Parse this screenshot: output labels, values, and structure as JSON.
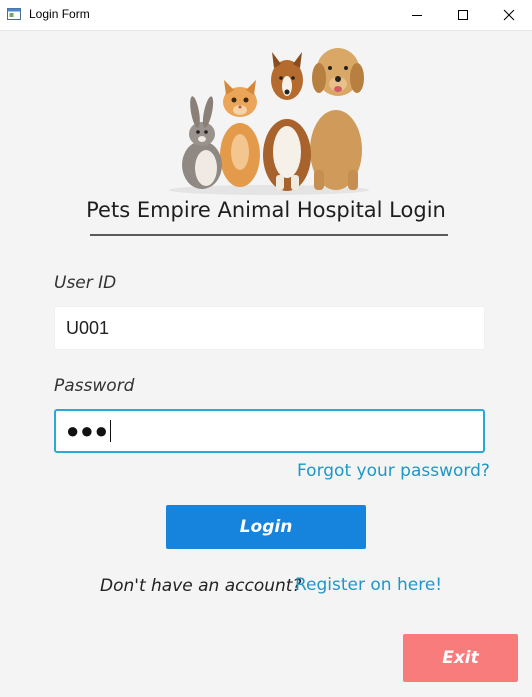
{
  "window": {
    "title": "Login Form",
    "icon": "app-window-icon",
    "controls": [
      "minimize-icon",
      "maximize-icon",
      "close-icon"
    ]
  },
  "header": {
    "image": "pets-group-image",
    "title": "Pets Empire Animal Hospital Login"
  },
  "form": {
    "user_id_label": "User ID",
    "user_id_value": "U001",
    "password_label": "Password",
    "password_masked": "●●●",
    "forgot_password": "Forgot your password?",
    "login_label": "Login"
  },
  "footer": {
    "no_account_text": "Don't have an account?",
    "register_link": "Register on here!",
    "exit_label": "Exit"
  },
  "colors": {
    "background": "#f4f4f4",
    "login_button": "#1683dc",
    "exit_button": "#f97c7c",
    "link": "#1f97c6",
    "focus_border": "#2aa8d8"
  }
}
